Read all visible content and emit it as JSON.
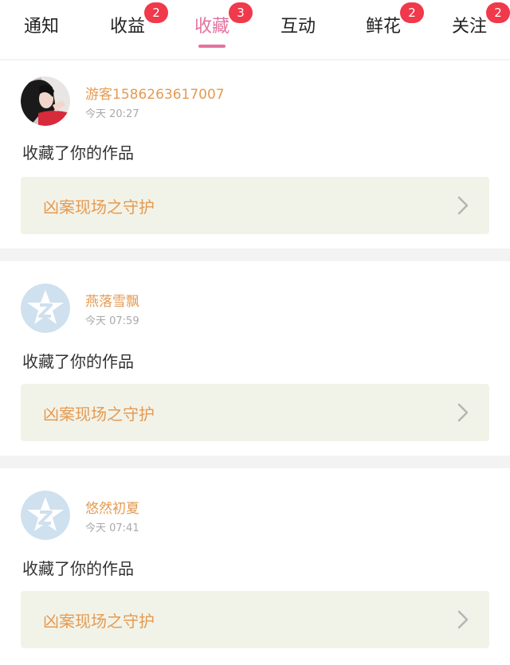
{
  "tabs": [
    {
      "label": "通知",
      "badge": ""
    },
    {
      "label": "收益",
      "badge": "2"
    },
    {
      "label": "收藏",
      "badge": "3"
    },
    {
      "label": "互动",
      "badge": ""
    },
    {
      "label": "鲜花",
      "badge": "2"
    },
    {
      "label": "关注",
      "badge": "2"
    }
  ],
  "colors": {
    "accent": "#e4739f",
    "badge": "#f0394a",
    "name": "#e49a52",
    "work_bg": "#f2f3e8"
  },
  "notifications": [
    {
      "username": "游客1586263617007",
      "time": "今天 20:27",
      "action": "收藏了你的作品",
      "work_title": "凶案现场之守护",
      "avatar": "photo-avatar"
    },
    {
      "username": "燕落雪飘",
      "time": "今天 07:59",
      "action": "收藏了你的作品",
      "work_title": "凶案现场之守护",
      "avatar": "default-star-avatar"
    },
    {
      "username": "悠然初夏",
      "time": "今天 07:41",
      "action": "收藏了你的作品",
      "work_title": "凶案现场之守护",
      "avatar": "default-star-avatar"
    }
  ]
}
